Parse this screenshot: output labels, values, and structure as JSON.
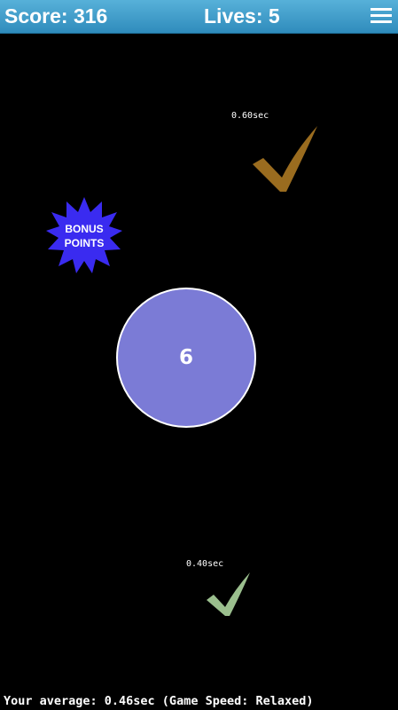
{
  "header": {
    "score": "Score: 316",
    "lives": "Lives: 5",
    "menu_icon": "hamburger-menu-icon"
  },
  "hits": [
    {
      "time": "0.60sec",
      "color": "#9a6c1f"
    },
    {
      "time": "0.40sec",
      "color": "#9bbf8e"
    }
  ],
  "bonus": {
    "line1": "BONUS",
    "line2": "POINTS",
    "color": "#3a2bf0"
  },
  "target": {
    "number": "6",
    "color": "#7b7bd6"
  },
  "footer": {
    "average": "Your average: 0.46sec (Game Speed: Relaxed)"
  },
  "colors": {
    "topbar": "#3f9ccb",
    "background": "#000000"
  }
}
